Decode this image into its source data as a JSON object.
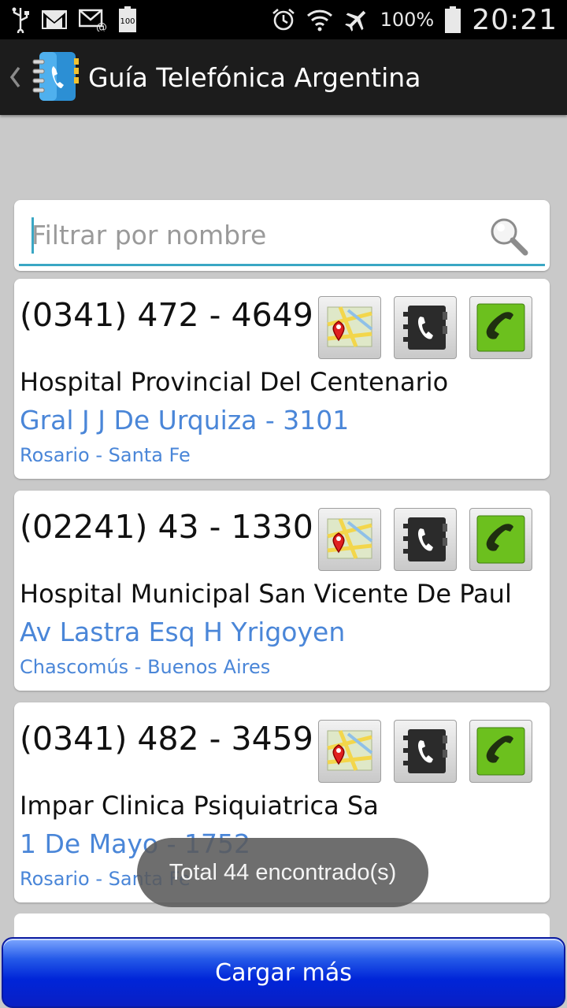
{
  "status_bar": {
    "battery_percent": "100%",
    "time": "20:21",
    "icons": [
      "usb-icon",
      "gmail-icon",
      "email-icon",
      "battery-saver-icon",
      "alarm-icon",
      "wifi-icon",
      "airplane-icon",
      "battery-icon"
    ],
    "battery_saver_label": "100"
  },
  "action_bar": {
    "title": "Guía Telefónica Argentina",
    "icon": "phonebook-app-icon"
  },
  "search": {
    "placeholder": "Filtrar por nombre",
    "value": "",
    "icon": "search-icon"
  },
  "results": [
    {
      "phone": "(0341) 472 - 4649",
      "name": "Hospital Provincial Del Centenario",
      "address": "Gral J J De Urquiza - 3101",
      "city": "Rosario - Santa Fe"
    },
    {
      "phone": "(02241) 43 - 1330",
      "name": "Hospital Municipal San Vicente De Paul",
      "address": "Av Lastra Esq H Yrigoyen",
      "city": "Chascomús - Buenos Aires"
    },
    {
      "phone": "(0341) 482 - 3459",
      "name": "Impar Clinica Psiquiatrica Sa",
      "address": "1 De Mayo - 1752",
      "city": "Rosario - Santa Fe"
    }
  ],
  "row_actions": [
    "map-icon",
    "contact-icon",
    "call-icon"
  ],
  "toast": "Total 44 encontrado(s)",
  "load_more_label": "Cargar más",
  "colors": {
    "accent": "#3aa7c4",
    "link": "#4a86d8",
    "button_blue": "#0025d8",
    "call_green": "#6cc01e"
  }
}
